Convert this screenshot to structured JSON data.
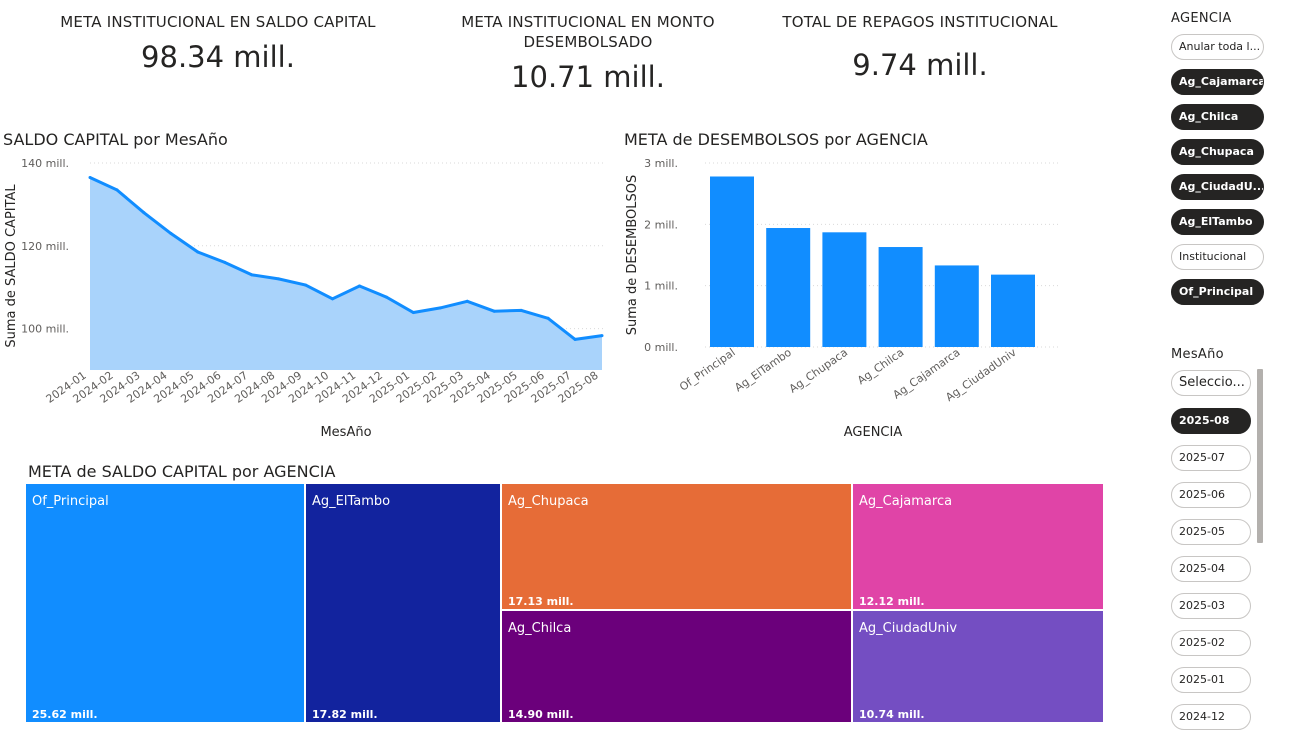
{
  "kpis": [
    {
      "title": "META INSTITUCIONAL EN SALDO CAPITAL",
      "value": "98.34 mill."
    },
    {
      "title": "META INSTITUCIONAL EN MONTO DESEMBOLSADO",
      "value": "10.71 mill."
    },
    {
      "title": "TOTAL DE REPAGOS INSTITUCIONAL",
      "value": "9.74 mill."
    }
  ],
  "colors": {
    "area_fill": "#a9d3fb",
    "area_line": "#118dff",
    "bar": "#118dff",
    "treemap": [
      "#118dff",
      "#12239e",
      "#e66c37",
      "#e044a7",
      "#6b007b",
      "#744ec2"
    ]
  },
  "chart_data": [
    {
      "type": "area",
      "title": "SALDO CAPITAL por MesAño",
      "xlabel": "MesAño",
      "ylabel": "Suma de SALDO CAPITAL",
      "ylim": [
        90,
        140
      ],
      "yticks": [
        100,
        120,
        140
      ],
      "ytick_labels": [
        "100 mill.",
        "120 mill.",
        "140 mill."
      ],
      "grid": true,
      "categories": [
        "2024-01",
        "2024-02",
        "2024-03",
        "2024-04",
        "2024-05",
        "2024-06",
        "2024-07",
        "2024-08",
        "2024-09",
        "2024-10",
        "2024-11",
        "2024-12",
        "2025-01",
        "2025-02",
        "2025-03",
        "2025-04",
        "2025-05",
        "2025-06",
        "2025-07",
        "2025-08"
      ],
      "values": [
        136.5,
        133.5,
        128.0,
        123.0,
        118.5,
        116.0,
        113.0,
        112.0,
        110.5,
        107.2,
        110.3,
        107.6,
        103.9,
        105.0,
        106.6,
        104.2,
        104.4,
        102.5,
        97.4,
        98.3
      ]
    },
    {
      "type": "bar",
      "title": "META de DESEMBOLSOS por AGENCIA",
      "xlabel": "AGENCIA",
      "ylabel": "Suma de DESEMBOLSOS",
      "ylim": [
        0,
        3
      ],
      "yticks": [
        0,
        1,
        2,
        3
      ],
      "ytick_labels": [
        "0 mill.",
        "1 mill.",
        "2 mill.",
        "3 mill."
      ],
      "grid": true,
      "categories": [
        "Of_Principal",
        "Ag_ElTambo",
        "Ag_Chupaca",
        "Ag_Chilca",
        "Ag_Cajamarca",
        "Ag_CiudadUniv"
      ],
      "values": [
        2.78,
        1.94,
        1.87,
        1.63,
        1.33,
        1.18
      ]
    },
    {
      "type": "treemap",
      "title": "META de SALDO CAPITAL por AGENCIA",
      "categories": [
        "Of_Principal",
        "Ag_ElTambo",
        "Ag_Chupaca",
        "Ag_Cajamarca",
        "Ag_Chilca",
        "Ag_CiudadUniv"
      ],
      "values": [
        25.62,
        17.82,
        17.13,
        12.12,
        14.9,
        10.74
      ],
      "value_labels": [
        "25.62 mill.",
        "17.82 mill.",
        "17.13 mill.",
        "12.12 mill.",
        "14.90 mill.",
        "10.74 mill."
      ]
    }
  ],
  "slicer_agencia": {
    "title": "AGENCIA",
    "clear_label": "Anular toda l...",
    "items": [
      {
        "label": "Ag_Cajamarca",
        "selected": true
      },
      {
        "label": "Ag_Chilca",
        "selected": true
      },
      {
        "label": "Ag_Chupaca",
        "selected": true
      },
      {
        "label": "Ag_CiudadU...",
        "selected": true
      },
      {
        "label": "Ag_ElTambo",
        "selected": true
      },
      {
        "label": "Institucional",
        "selected": false
      },
      {
        "label": "Of_Principal",
        "selected": true
      }
    ]
  },
  "slicer_mesano": {
    "title": "MesAño",
    "clear_label": "Seleccio...",
    "items": [
      {
        "label": "2025-08",
        "selected": true
      },
      {
        "label": "2025-07",
        "selected": false
      },
      {
        "label": "2025-06",
        "selected": false
      },
      {
        "label": "2025-05",
        "selected": false
      },
      {
        "label": "2025-04",
        "selected": false
      },
      {
        "label": "2025-03",
        "selected": false
      },
      {
        "label": "2025-02",
        "selected": false
      },
      {
        "label": "2025-01",
        "selected": false
      },
      {
        "label": "2024-12",
        "selected": false
      }
    ]
  }
}
